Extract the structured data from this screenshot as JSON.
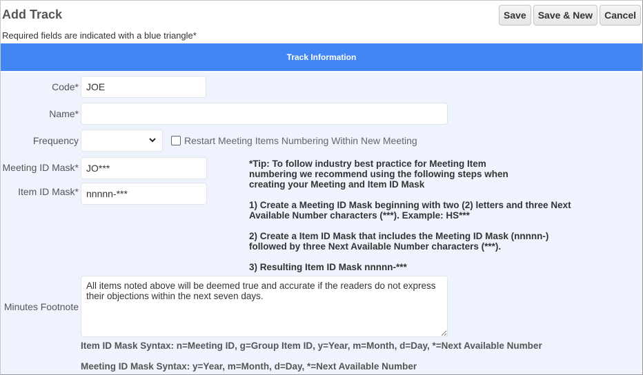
{
  "header": {
    "title": "Add Track",
    "required_note": "Required fields are indicated with a blue triangle*",
    "buttons": {
      "save": "Save",
      "save_new": "Save & New",
      "cancel": "Cancel"
    }
  },
  "section": {
    "title": "Track Information",
    "accent_color": "#4285f4",
    "background_color": "#eef3fd"
  },
  "form": {
    "code": {
      "label": "Code*",
      "value": "JOE"
    },
    "name": {
      "label": "Name*",
      "value": ""
    },
    "frequency": {
      "label": "Frequency",
      "selected": ""
    },
    "restart_numbering": {
      "label": "Restart Meeting Items Numbering Within New Meeting",
      "checked": false
    },
    "meeting_id_mask": {
      "label": "Meeting ID Mask*",
      "value": "JO***"
    },
    "item_id_mask": {
      "label": "Item ID Mask*",
      "value": "nnnnn-***"
    },
    "minutes_footnote": {
      "label": "Minutes Footnote",
      "value": "All items noted above will be deemed true and accurate if the readers do not express their objections within the next seven days."
    }
  },
  "tip": {
    "intro": [
      "*Tip: To follow industry best practice for Meeting Item",
      "numbering we recommend using the following steps when",
      "creating your Meeting and Item ID Mask"
    ],
    "step1": [
      "1) Create a Meeting ID Mask beginning with two (2) letters and three Next",
      "Available Number characters (***). Example: HS***"
    ],
    "step2": [
      "2) Create a Item ID Mask that includes the Meeting ID Mask (nnnnn-)",
      "followed by three Next Available Number characters (***)."
    ],
    "step3": "3) Resulting Item ID Mask nnnnn-***"
  },
  "syntax": {
    "item_id": "Item ID Mask Syntax: n=Meeting ID, g=Group Item ID, y=Year, m=Month, d=Day, *=Next Available Number",
    "meeting_id": "Meeting ID Mask Syntax: y=Year, m=Month, d=Day, *=Next Available Number"
  }
}
